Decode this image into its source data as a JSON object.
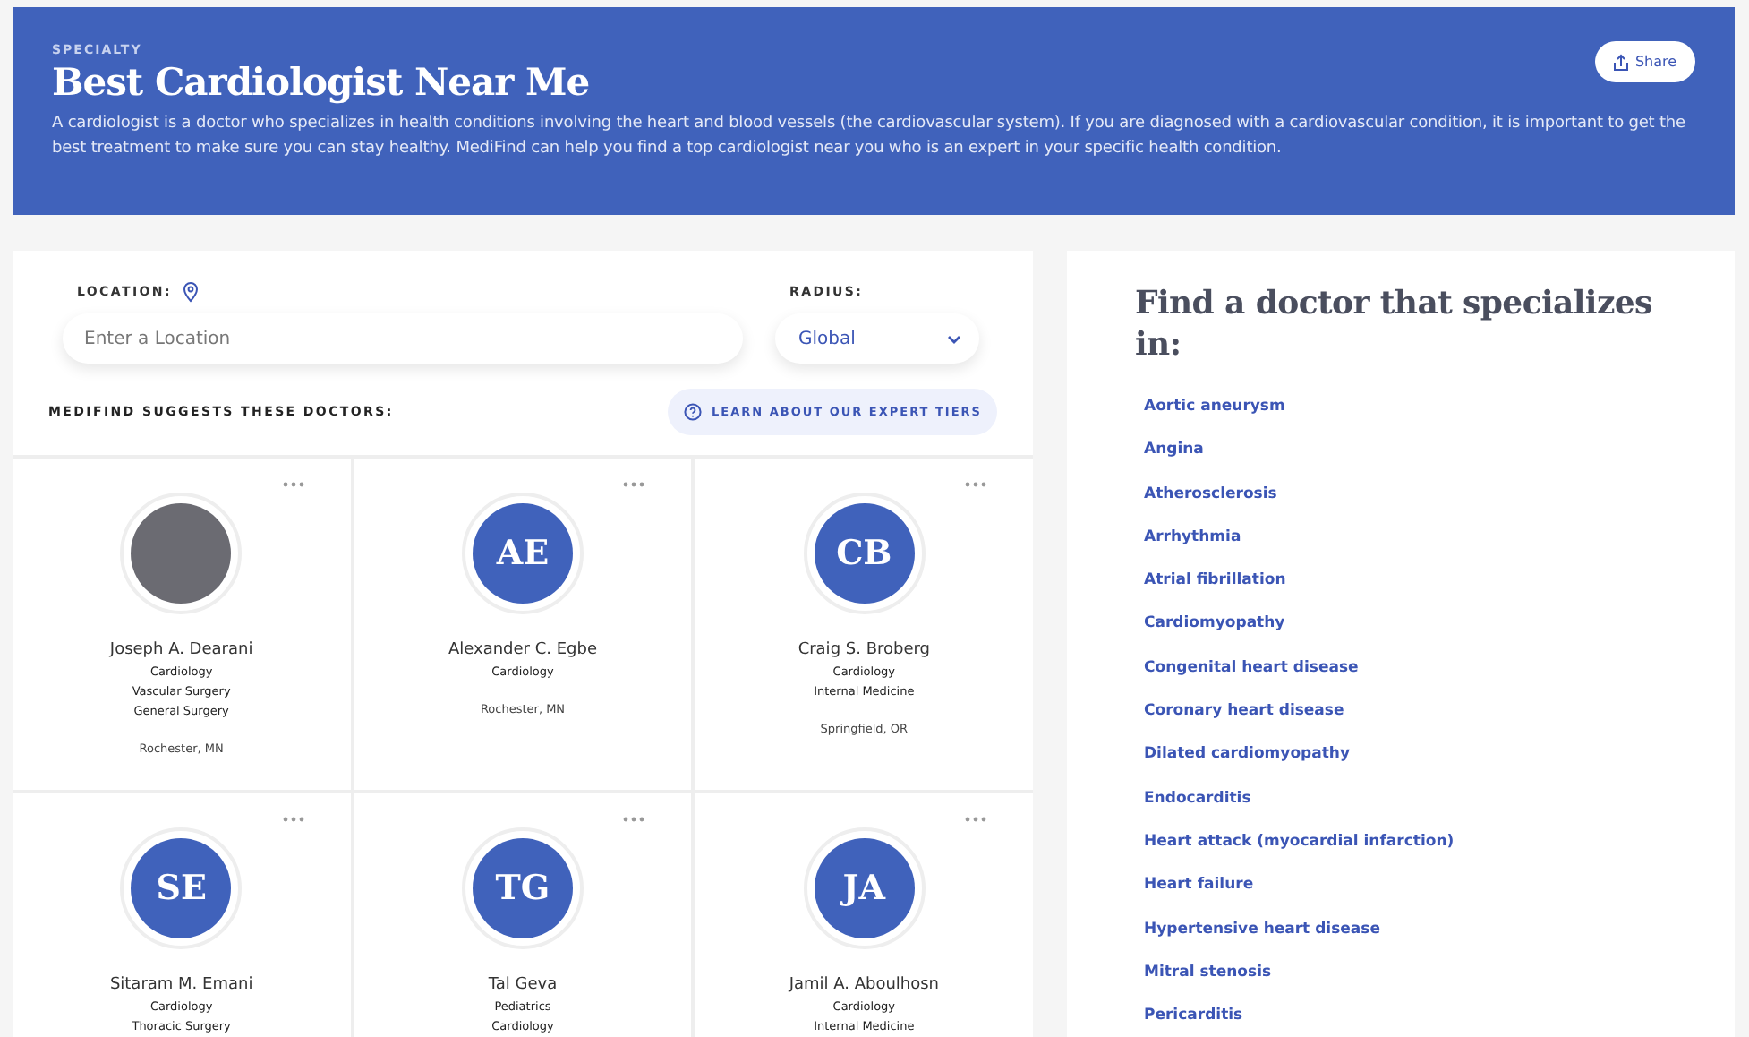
{
  "header": {
    "eyebrow": "SPECIALTY",
    "title": "Best Cardiologist Near Me",
    "description": "A cardiologist is a doctor who specializes in health conditions involving the heart and blood vessels (the cardiovascular system). If you are diagnosed with a cardiovascular condition, it is important to get the best treatment to make sure you can stay healthy. MediFind can help you find a top cardiologist near you who is an expert in your specific health condition.",
    "share_button": "Share"
  },
  "search": {
    "location_label": "LOCATION:",
    "location_placeholder": "Enter a Location",
    "radius_label": "RADIUS:",
    "radius_value": "Global"
  },
  "suggest_label": "MEDIFIND SUGGESTS THESE DOCTORS:",
  "tiers_button": "LEARN ABOUT OUR EXPERT TIERS",
  "doctors": [
    {
      "kind": "photo",
      "name": "Joseph A. Dearani",
      "specialties": [
        "Cardiology",
        "Vascular Surgery",
        "General Surgery"
      ],
      "location": "Rochester, MN"
    },
    {
      "kind": "initials",
      "initials": "AE",
      "name": "Alexander C. Egbe",
      "specialties": [
        "Cardiology"
      ],
      "location": "Rochester, MN"
    },
    {
      "kind": "initials",
      "initials": "CB",
      "name": "Craig S. Broberg",
      "specialties": [
        "Cardiology",
        "Internal Medicine"
      ],
      "location": "Springfield, OR"
    },
    {
      "kind": "initials",
      "initials": "SE",
      "name": "Sitaram M. Emani",
      "specialties": [
        "Cardiology",
        "Thoracic Surgery"
      ]
    },
    {
      "kind": "initials",
      "initials": "TG",
      "name": "Tal Geva",
      "specialties": [
        "Pediatrics",
        "Cardiology"
      ]
    },
    {
      "kind": "initials",
      "initials": "JA",
      "name": "Jamil A. Aboulhosn",
      "specialties": [
        "Cardiology",
        "Internal Medicine"
      ]
    }
  ],
  "conditions": {
    "title": "Find a doctor that specializes in:",
    "items": [
      "Aortic aneurysm",
      "Angina",
      "Atherosclerosis",
      "Arrhythmia",
      "Atrial fibrillation",
      "Cardiomyopathy",
      "Congenital heart disease",
      "Coronary heart disease",
      "Dilated cardiomyopathy",
      "Endocarditis",
      "Heart attack (myocardial infarction)",
      "Heart failure",
      "Hypertensive heart disease",
      "Mitral stenosis",
      "Pericarditis"
    ]
  }
}
